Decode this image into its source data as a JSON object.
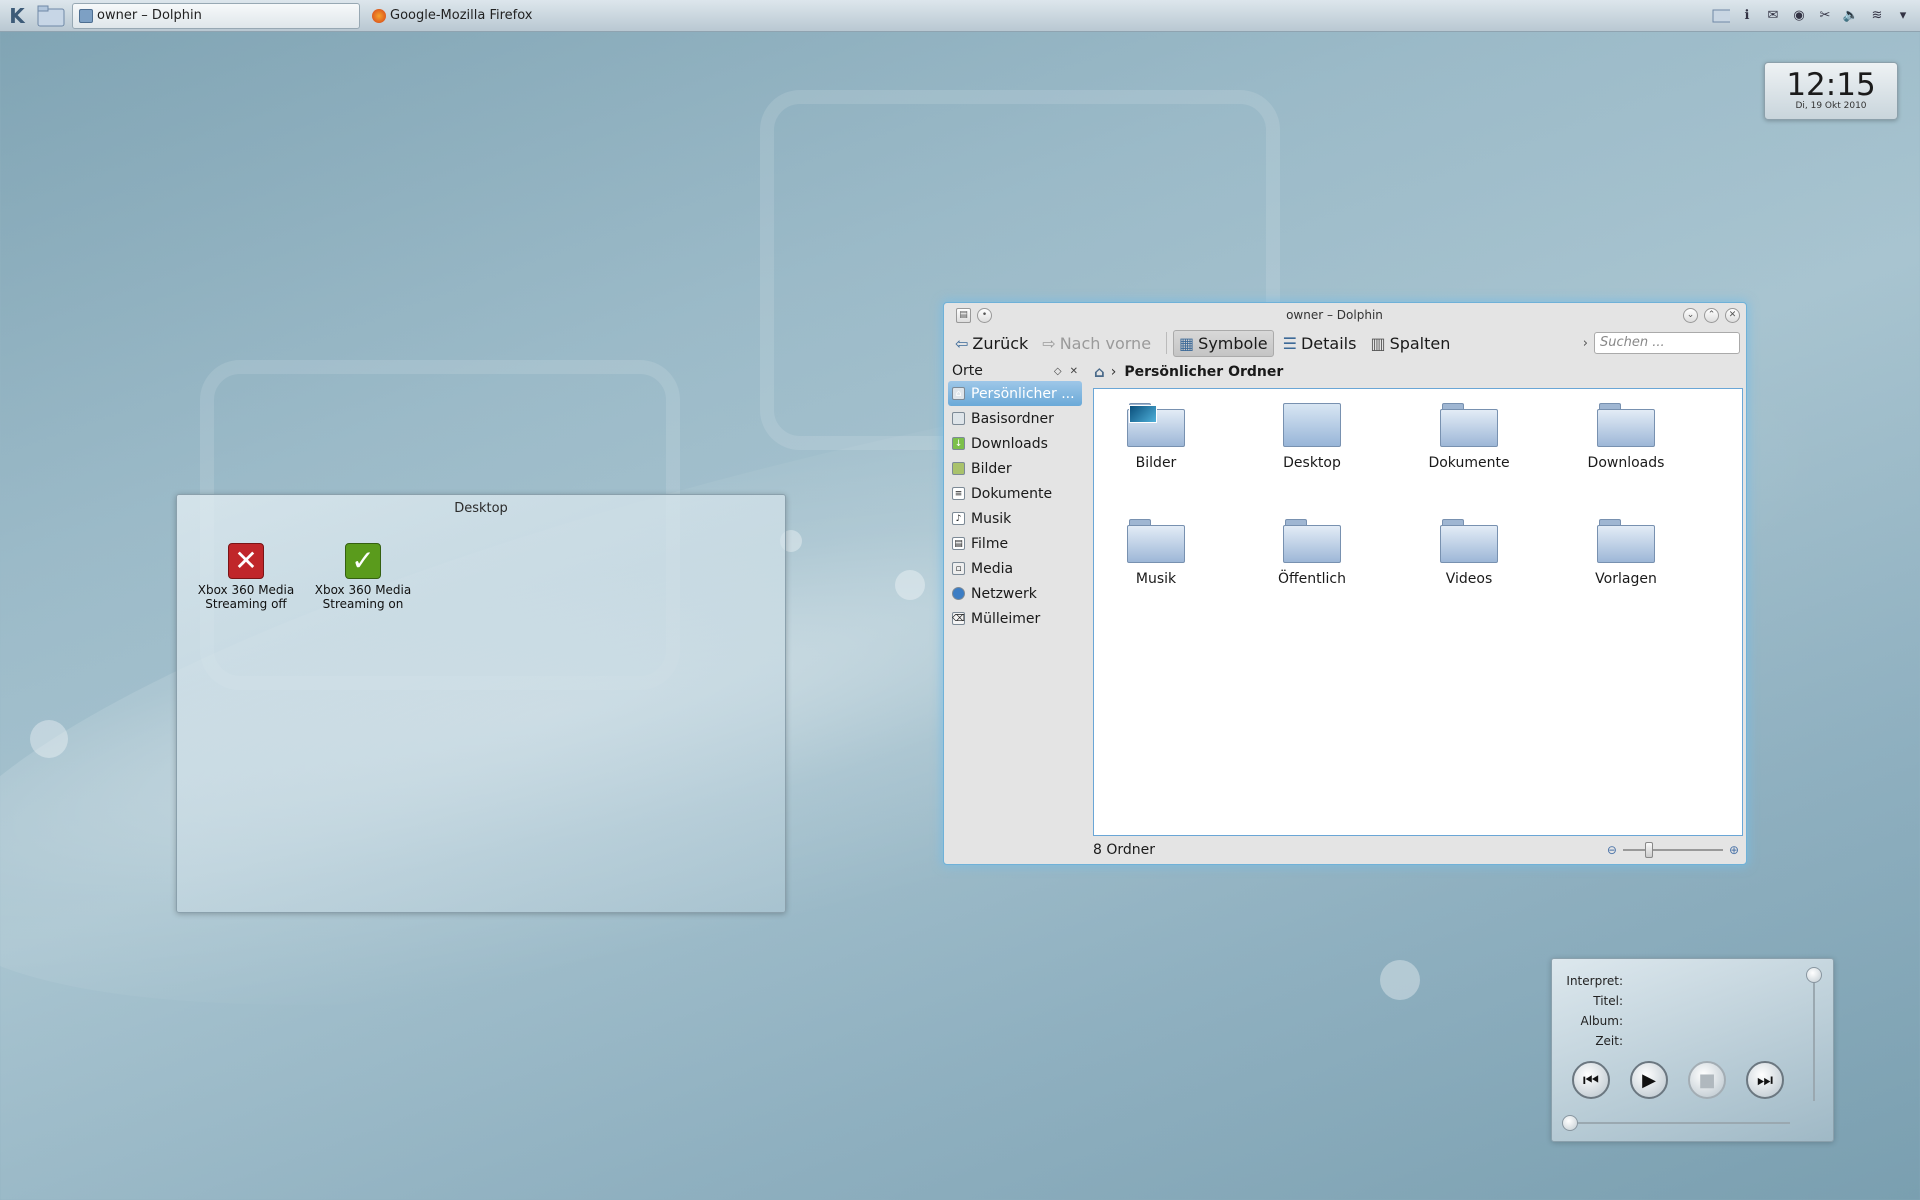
{
  "taskbar": {
    "tasks": [
      {
        "label": "owner – Dolphin",
        "active": true
      },
      {
        "label": "Google-Mozilla Firefox",
        "active": false
      }
    ]
  },
  "clock": {
    "time": "12:15",
    "date": "Di, 19 Okt 2010"
  },
  "desktop_view": {
    "title": "Desktop",
    "icons": [
      {
        "line1": "Xbox 360 Media",
        "line2": "Streaming off",
        "icon": "red-x-icon",
        "color": "#c0262a"
      },
      {
        "line1": "Xbox 360 Media",
        "line2": "Streaming on",
        "icon": "green-check-icon",
        "color": "#5a9b1c"
      }
    ]
  },
  "dolphin": {
    "title": "owner – Dolphin",
    "toolbar": {
      "back": "Zurück",
      "forward": "Nach vorne",
      "icons_view": "Symbole",
      "details_view": "Details",
      "columns_view": "Spalten",
      "search_placeholder": "Suchen ..."
    },
    "places": {
      "title": "Orte",
      "items": [
        {
          "label": "Persönlicher ...",
          "selected": true
        },
        {
          "label": "Basisordner"
        },
        {
          "label": "Downloads"
        },
        {
          "label": "Bilder"
        },
        {
          "label": "Dokumente"
        },
        {
          "label": "Musik"
        },
        {
          "label": "Filme"
        },
        {
          "label": "Media"
        },
        {
          "label": "Netzwerk"
        },
        {
          "label": "Mülleimer"
        }
      ]
    },
    "breadcrumb": "Persönlicher Ordner",
    "files": [
      {
        "label": "Bilder"
      },
      {
        "label": "Desktop"
      },
      {
        "label": "Dokumente"
      },
      {
        "label": "Downloads"
      },
      {
        "label": "Musik"
      },
      {
        "label": "Öffentlich"
      },
      {
        "label": "Videos"
      },
      {
        "label": "Vorlagen"
      }
    ],
    "status": "8 Ordner"
  },
  "player": {
    "artist_label": "Interpret:",
    "title_label": "Titel:",
    "album_label": "Album:",
    "time_label": "Zeit:"
  },
  "colors": {
    "selection": "#6aa9d8",
    "window_glow": "#78bee6"
  }
}
